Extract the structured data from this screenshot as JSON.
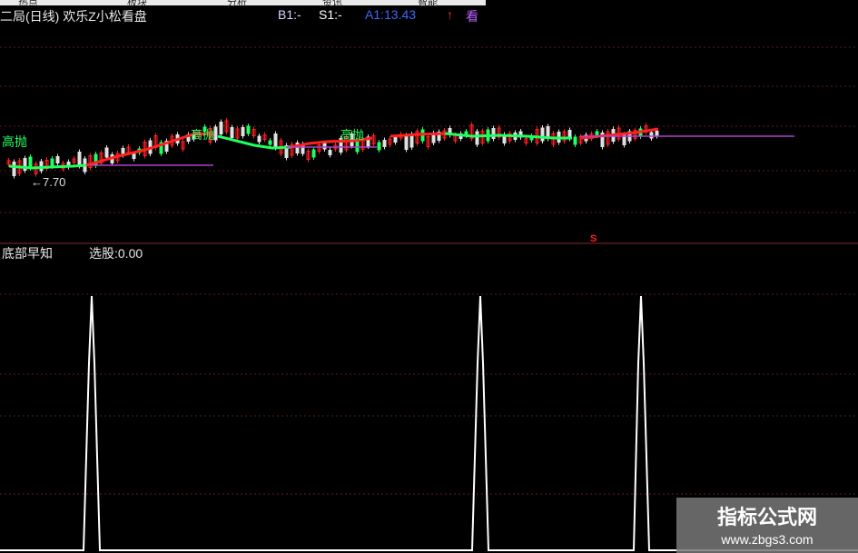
{
  "toolbar": {
    "items": [
      "热点",
      "板块",
      "分析",
      "资讯",
      "智能"
    ]
  },
  "header": {
    "title": "二局(日线) 欢乐Z小松看盘",
    "b1": "B1:-",
    "s1": "S1:-",
    "a1": "A1:13.43",
    "arrow": "↑",
    "hint": "看"
  },
  "main_chart": {
    "label_left": "高抛",
    "label_mid1": "高抛",
    "label_mid2": "高抛",
    "low_marker": "←7.70",
    "s_marker": "S"
  },
  "indicator": {
    "title": "底部早知",
    "value": "选股:0.00",
    "chart_data": {
      "type": "line",
      "series": [
        {
          "values": [
            0,
            1,
            0,
            1,
            0,
            1,
            0
          ]
        }
      ],
      "ylim": [
        0,
        1
      ]
    }
  },
  "watermark": {
    "line1": "指标公式网",
    "line2": "www.zbgs3.com"
  },
  "colors": {
    "background": "#000000",
    "up": "#ff2020",
    "down": "#20ff60",
    "line": "#ffffff"
  }
}
